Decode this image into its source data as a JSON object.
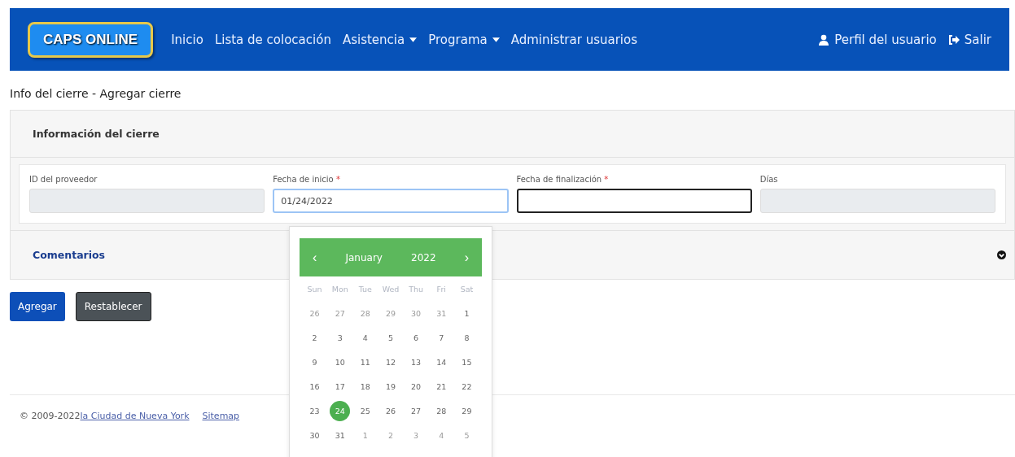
{
  "navbar": {
    "logo": "CAPS ONLINE",
    "links": [
      {
        "label": "Inicio",
        "dropdown": false
      },
      {
        "label": "Lista de colocación",
        "dropdown": false
      },
      {
        "label": "Asistencia",
        "dropdown": true
      },
      {
        "label": "Programa",
        "dropdown": true
      },
      {
        "label": "Administrar usuarios",
        "dropdown": false
      }
    ],
    "profile": "Perfil del usuario",
    "logout": "Salir"
  },
  "page_title": "Info del cierre - Agregar cierre",
  "section": {
    "title": "Información del cierre"
  },
  "fields": [
    {
      "label": "ID del proveedor",
      "required": false,
      "disabled": true,
      "focused": false
    },
    {
      "label": "Fecha de inicio",
      "required": true,
      "disabled": false,
      "focused": true,
      "value": "01/24/2022"
    },
    {
      "label": "Fecha de finalización",
      "required": true,
      "disabled": false,
      "focused": false
    },
    {
      "label": "Días",
      "required": false,
      "disabled": true,
      "focused": false
    }
  ],
  "required_mark": "*",
  "comments": {
    "title": "Comentarios",
    "expanded": false
  },
  "buttons": [
    {
      "label": "Agregar",
      "kind": "primary"
    },
    {
      "label": "Restablecer",
      "kind": "secondary"
    }
  ],
  "datepicker": {
    "prev": "‹",
    "month": "January",
    "year": "2022",
    "next": "›",
    "weekdays": [
      "Sun",
      "Mon",
      "Tue",
      "Wed",
      "Thu",
      "Fri",
      "Sat"
    ],
    "weeks": [
      [
        {
          "day": "26",
          "muted": true,
          "selected": false
        },
        {
          "day": "27",
          "muted": true,
          "selected": false
        },
        {
          "day": "28",
          "muted": true,
          "selected": false
        },
        {
          "day": "29",
          "muted": true,
          "selected": false
        },
        {
          "day": "30",
          "muted": true,
          "selected": false
        },
        {
          "day": "31",
          "muted": true,
          "selected": false
        },
        {
          "day": "1",
          "muted": false,
          "selected": false
        }
      ],
      [
        {
          "day": "2",
          "muted": false,
          "selected": false
        },
        {
          "day": "3",
          "muted": false,
          "selected": false
        },
        {
          "day": "4",
          "muted": false,
          "selected": false
        },
        {
          "day": "5",
          "muted": false,
          "selected": false
        },
        {
          "day": "6",
          "muted": false,
          "selected": false
        },
        {
          "day": "7",
          "muted": false,
          "selected": false
        },
        {
          "day": "8",
          "muted": false,
          "selected": false
        }
      ],
      [
        {
          "day": "9",
          "muted": false,
          "selected": false
        },
        {
          "day": "10",
          "muted": false,
          "selected": false
        },
        {
          "day": "11",
          "muted": false,
          "selected": false
        },
        {
          "day": "12",
          "muted": false,
          "selected": false
        },
        {
          "day": "13",
          "muted": false,
          "selected": false
        },
        {
          "day": "14",
          "muted": false,
          "selected": false
        },
        {
          "day": "15",
          "muted": false,
          "selected": false
        }
      ],
      [
        {
          "day": "16",
          "muted": false,
          "selected": false
        },
        {
          "day": "17",
          "muted": false,
          "selected": false
        },
        {
          "day": "18",
          "muted": false,
          "selected": false
        },
        {
          "day": "19",
          "muted": false,
          "selected": false
        },
        {
          "day": "20",
          "muted": false,
          "selected": false
        },
        {
          "day": "21",
          "muted": false,
          "selected": false
        },
        {
          "day": "22",
          "muted": false,
          "selected": false
        }
      ],
      [
        {
          "day": "23",
          "muted": false,
          "selected": false
        },
        {
          "day": "24",
          "muted": false,
          "selected": true
        },
        {
          "day": "25",
          "muted": false,
          "selected": false
        },
        {
          "day": "26",
          "muted": false,
          "selected": false
        },
        {
          "day": "27",
          "muted": false,
          "selected": false
        },
        {
          "day": "28",
          "muted": false,
          "selected": false
        },
        {
          "day": "29",
          "muted": false,
          "selected": false
        }
      ],
      [
        {
          "day": "30",
          "muted": false,
          "selected": false
        },
        {
          "day": "31",
          "muted": false,
          "selected": false
        },
        {
          "day": "1",
          "muted": true,
          "selected": false
        },
        {
          "day": "2",
          "muted": true,
          "selected": false
        },
        {
          "day": "3",
          "muted": true,
          "selected": false
        },
        {
          "day": "4",
          "muted": true,
          "selected": false
        },
        {
          "day": "5",
          "muted": true,
          "selected": false
        }
      ]
    ]
  },
  "footer": {
    "copyright": "© 2009-2022",
    "city_link": "la Ciudad de Nueva York",
    "sitemap": "Sitemap"
  }
}
